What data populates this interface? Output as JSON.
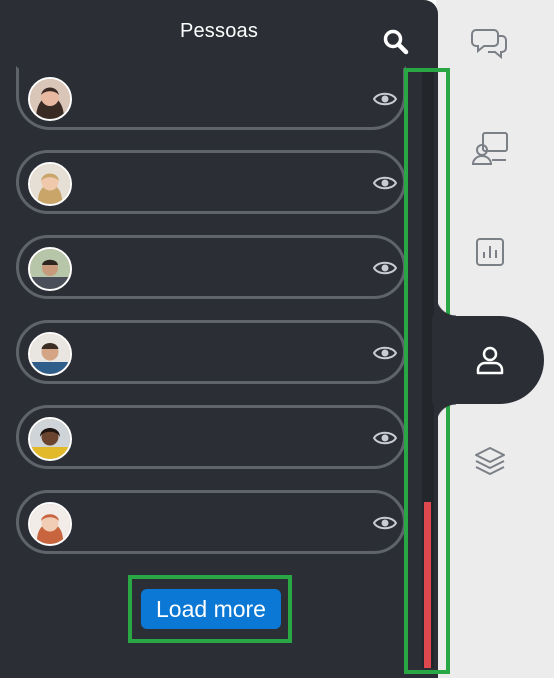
{
  "panel": {
    "title": "Pessoas",
    "search_icon": "search-icon"
  },
  "people": [
    {
      "avatar": "avatar-woman-dark-hair",
      "visibility_icon": "eye-icon"
    },
    {
      "avatar": "avatar-woman-blonde-hair",
      "visibility_icon": "eye-icon"
    },
    {
      "avatar": "avatar-man-outdoors",
      "visibility_icon": "eye-icon"
    },
    {
      "avatar": "avatar-man-short-hair",
      "visibility_icon": "eye-icon"
    },
    {
      "avatar": "avatar-woman-yellow-top",
      "visibility_icon": "eye-icon"
    },
    {
      "avatar": "avatar-woman-red-hair",
      "visibility_icon": "eye-icon"
    }
  ],
  "load_more": {
    "label": "Load more"
  },
  "scrollbar": {
    "thumb_color": "#e0484f",
    "highlight_color": "#29a745"
  },
  "sidebar": {
    "items": [
      {
        "name": "chat",
        "icon": "chat-bubbles-icon",
        "active": false
      },
      {
        "name": "presentation",
        "icon": "presenter-icon",
        "active": false
      },
      {
        "name": "stats",
        "icon": "bar-chart-icon",
        "active": false
      },
      {
        "name": "people",
        "icon": "user-icon",
        "active": true
      },
      {
        "name": "layers",
        "icon": "layers-icon",
        "active": false
      }
    ]
  },
  "colors": {
    "panel_bg": "#2b2f35",
    "button_blue": "#0a78d4",
    "rail_bg": "#ececec"
  }
}
